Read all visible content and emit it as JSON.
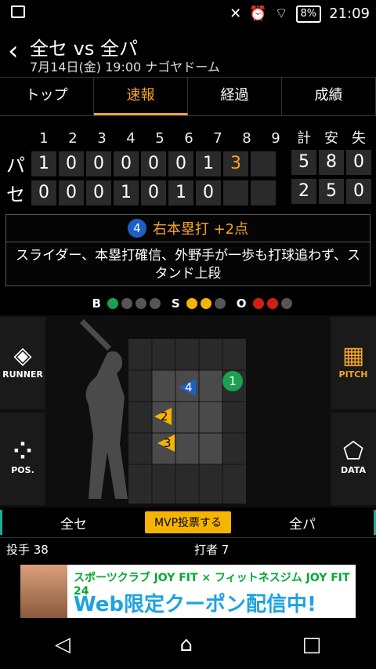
{
  "status": {
    "battery": "8%",
    "time": "21:09"
  },
  "header": {
    "title": "全セ vs 全パ",
    "subtitle": "7月14日(金) 19:00 ナゴヤドーム"
  },
  "tabs": [
    "トップ",
    "速報",
    "経過",
    "成績"
  ],
  "scoreboard": {
    "innings": [
      "1",
      "2",
      "3",
      "4",
      "5",
      "6",
      "7",
      "8",
      "9"
    ],
    "totals_head": [
      "計",
      "安",
      "失"
    ],
    "rows": [
      {
        "team": "パ",
        "scores": [
          "1",
          "0",
          "0",
          "0",
          "0",
          "0",
          "1",
          "3",
          ""
        ],
        "totals": [
          "5",
          "8",
          "0"
        ]
      },
      {
        "team": "セ",
        "scores": [
          "0",
          "0",
          "0",
          "1",
          "0",
          "1",
          "0",
          "",
          ""
        ],
        "totals": [
          "2",
          "5",
          "0"
        ]
      }
    ]
  },
  "play": {
    "badge": "4",
    "headline": "右本塁打 +2点",
    "description": "スライダー、本塁打確信、外野手が一歩も打球追わず、スタンド上段"
  },
  "count": {
    "b": "B",
    "s": "S",
    "o": "O"
  },
  "side": {
    "runner": "RUNNER",
    "pos": "POS.",
    "pitch": "PITCH",
    "data": "DATA"
  },
  "pitches": {
    "p1": "1",
    "p2": "2",
    "p3": "3",
    "p4": "4"
  },
  "mvp": {
    "team_a": "全セ",
    "button": "MVP投票する",
    "team_b": "全パ"
  },
  "players": {
    "pitcher": "投手 38",
    "batter": "打者 7"
  },
  "ad": {
    "line1": "スポーツクラブ JOY FIT × フィットネスジム JOY FIT 24",
    "line2": "Web限定クーポン配信中!"
  }
}
